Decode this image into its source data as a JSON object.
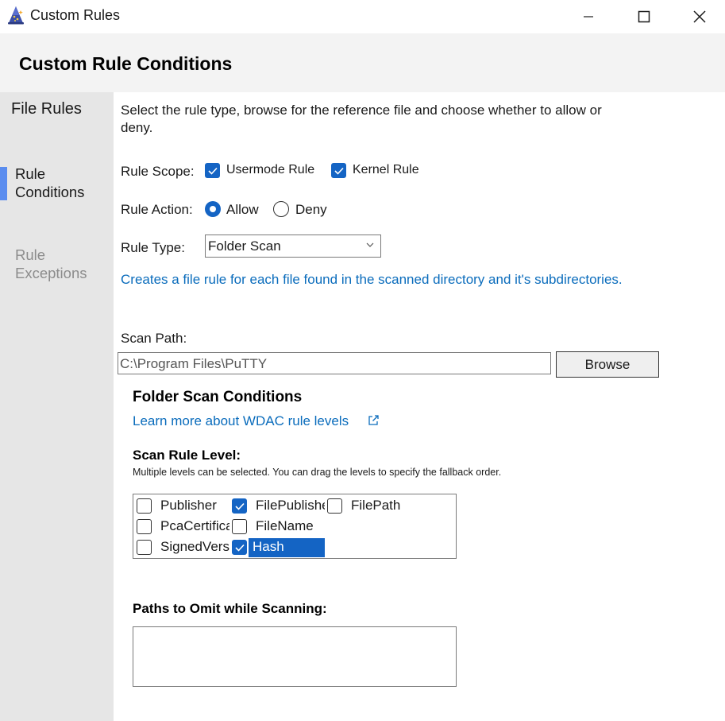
{
  "window": {
    "title": "Custom Rules"
  },
  "page": {
    "title": "Custom Rule Conditions"
  },
  "sidebar": {
    "heading": "File Rules",
    "items": [
      {
        "label_line1": "Rule",
        "label_line2": "Conditions",
        "active": true
      },
      {
        "label_line1": "Rule",
        "label_line2": "Exceptions",
        "active": false
      }
    ]
  },
  "main": {
    "description": "Select the rule type, browse for the reference file and choose whether to allow or deny.",
    "rule_scope": {
      "label": "Rule Scope:",
      "options": [
        {
          "label": "Usermode Rule",
          "checked": true
        },
        {
          "label": "Kernel Rule",
          "checked": true
        }
      ]
    },
    "rule_action": {
      "label": "Rule Action:",
      "options": [
        {
          "label": "Allow",
          "selected": true
        },
        {
          "label": "Deny",
          "selected": false
        }
      ]
    },
    "rule_type": {
      "label": "Rule Type:",
      "value": "Folder Scan"
    },
    "rule_type_info": "Creates a file rule for each file found in the scanned directory and it's subdirectories.",
    "scan_path": {
      "label": "Scan Path:",
      "value": "C:\\Program Files\\PuTTY",
      "browse_label": "Browse"
    },
    "folder_scan": {
      "title": "Folder Scan Conditions",
      "learn_more": "Learn more about WDAC rule levels",
      "level_title": "Scan Rule Level:",
      "level_note": "Multiple levels can be selected. You can drag the levels to specify the fallback order.",
      "levels": [
        {
          "label": "Publisher",
          "checked": false,
          "selected": false
        },
        {
          "label": "FilePublisher",
          "checked": true,
          "selected": false
        },
        {
          "label": "FilePath",
          "checked": false,
          "selected": false
        },
        {
          "label": "PcaCertificate",
          "checked": false,
          "selected": false
        },
        {
          "label": "FileName",
          "checked": false,
          "selected": false
        },
        {
          "label": "SignedVersion",
          "checked": false,
          "selected": false
        },
        {
          "label": "Hash",
          "checked": true,
          "selected": true
        }
      ]
    },
    "omit": {
      "title": "Paths to Omit while Scanning:",
      "value": ""
    }
  },
  "colors": {
    "accent": "#1464c4",
    "link": "#0a6cbc",
    "sidebar_bg": "#e6e6e6",
    "header_bg": "#f3f3f3",
    "sidebar_indicator": "#5b8def"
  },
  "icons": {
    "app": "wizard-hat-icon",
    "minimize": "minimize-icon",
    "maximize": "maximize-icon",
    "close": "close-icon",
    "dropdown": "chevron-down-icon",
    "external_link": "external-link-icon",
    "check": "checkmark-icon"
  }
}
